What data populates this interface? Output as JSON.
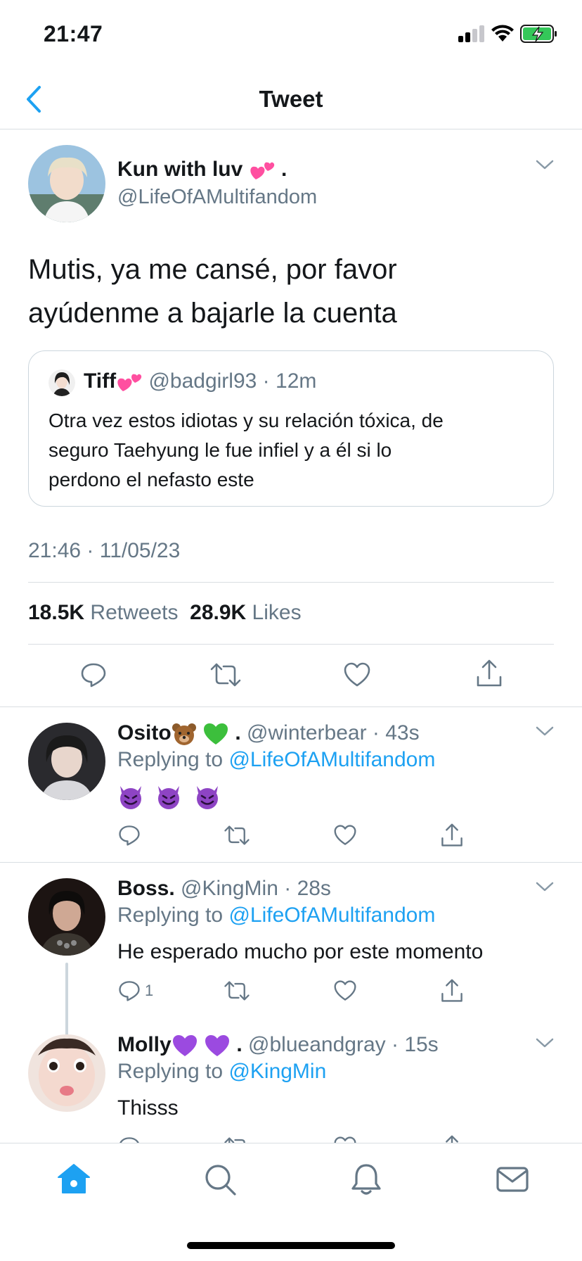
{
  "status_bar": {
    "time": "21:47"
  },
  "header": {
    "title": "Tweet",
    "back_icon": "chevron-left-icon"
  },
  "main_tweet": {
    "author_name": "Kun with luv",
    "author_name_suffix": ".",
    "author_emoji": "two-hearts",
    "handle": "@LifeOfAMultifandom",
    "text_line1": "Mutis, ya me cansé, por favor",
    "text_line2": "ayúdenme a bajarle la cuenta",
    "quote": {
      "name": "Tiff",
      "name_emoji": "two-hearts",
      "handle": "@badgirl93",
      "time": "12m",
      "text_line1": "Otra vez estos idiotas y su relación tóxica, de",
      "text_line2": "seguro Taehyung le fue infiel y a él si lo",
      "text_line3": "perdono el nefasto este"
    },
    "timestamp": "21:46 · 11/05/23",
    "retweets_count": "18.5K",
    "retweets_label": "Retweets",
    "likes_count": "28.9K",
    "likes_label": "Likes"
  },
  "replies": [
    {
      "name": "Osito",
      "name_suffix": ".",
      "emojis": [
        "bear",
        "green-heart"
      ],
      "handle": "@winterbear",
      "time": "43s",
      "replying_label": "Replying to",
      "replying_to": "@LifeOfAMultifandom",
      "body_emojis": [
        "smiling-imp",
        "smiling-imp",
        "smiling-imp"
      ],
      "reply_count": ""
    },
    {
      "name": "Boss.",
      "handle": "@KingMin",
      "time": "28s",
      "replying_label": "Replying to",
      "replying_to": "@LifeOfAMultifandom",
      "body": "He esperado mucho por este momento",
      "reply_count": "1"
    },
    {
      "name": "Molly",
      "name_suffix": ".",
      "emojis": [
        "purple-heart",
        "purple-heart"
      ],
      "handle": "@blueandgray",
      "time": "15s",
      "replying_label": "Replying to",
      "replying_to": "@KingMin",
      "body": "Thisss"
    }
  ],
  "tab_bar": {
    "tabs": [
      "home-icon",
      "search-icon",
      "notifications-icon",
      "messages-icon"
    ],
    "active": "home-icon"
  },
  "colors": {
    "accent": "#1da1f2",
    "secondary_text": "#657786",
    "divider": "#d9dee2",
    "battery_green": "#34c759",
    "devil_purple": "#8e44c4",
    "heart_purple": "#9b4ae0",
    "heart_green": "#3cbf3c",
    "heart_pink": "#ff4fa0"
  }
}
